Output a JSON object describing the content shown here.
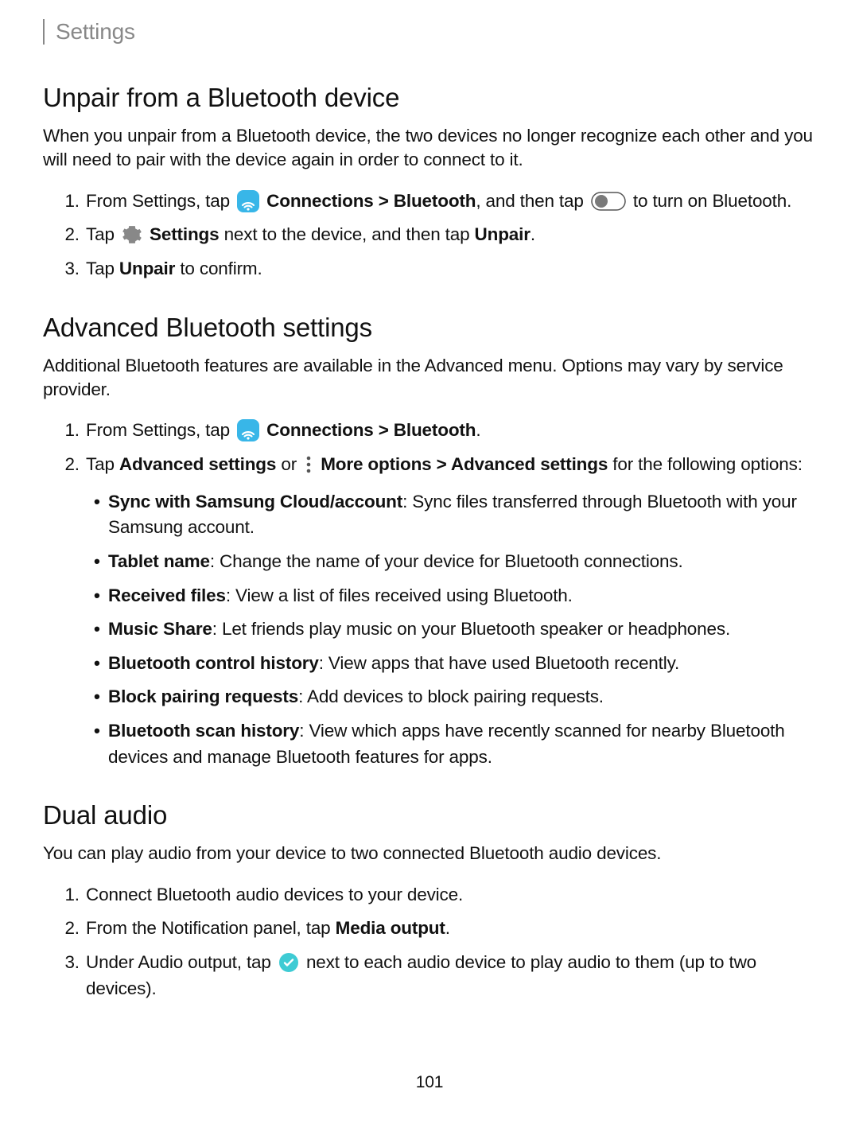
{
  "header": {
    "section": "Settings"
  },
  "unpair": {
    "title": "Unpair from a Bluetooth device",
    "intro": "When you unpair from a Bluetooth device, the two devices no longer recognize each other and you will need to pair with the device again in order to connect to it.",
    "steps": {
      "s1a": "From Settings, tap",
      "s1b": "Connections > Bluetooth",
      "s1c": ", and then tap",
      "s1d": "to turn on Bluetooth.",
      "s2a": "Tap",
      "s2b": "Settings",
      "s2c": "next to the device, and then tap",
      "s2d": "Unpair",
      "s2e": ".",
      "s3a": "Tap",
      "s3b": "Unpair",
      "s3c": "to confirm."
    }
  },
  "advanced": {
    "title": "Advanced Bluetooth settings",
    "intro": "Additional Bluetooth features are available in the Advanced menu. Options may vary by service provider.",
    "steps": {
      "s1a": "From Settings, tap",
      "s1b": "Connections > Bluetooth",
      "s1c": ".",
      "s2a": "Tap",
      "s2b": "Advanced settings",
      "s2c": "or",
      "s2d": "More options > Advanced settings",
      "s2e": "for the following options:"
    },
    "options": [
      {
        "term": "Sync with Samsung Cloud/account",
        "desc": ": Sync files transferred through Bluetooth with your Samsung account."
      },
      {
        "term": "Tablet name",
        "desc": ": Change the name of your device for Bluetooth connections."
      },
      {
        "term": "Received files",
        "desc": ": View a list of files received using Bluetooth."
      },
      {
        "term": "Music Share",
        "desc": ": Let friends play music on your Bluetooth speaker or headphones."
      },
      {
        "term": "Bluetooth control history",
        "desc": ": View apps that have used Bluetooth recently."
      },
      {
        "term": "Block pairing requests",
        "desc": ": Add devices to block pairing requests."
      },
      {
        "term": "Bluetooth scan history",
        "desc": ": View which apps have recently scanned for nearby Bluetooth devices and manage Bluetooth features for apps."
      }
    ]
  },
  "dual": {
    "title": "Dual audio",
    "intro": "You can play audio from your device to two connected Bluetooth audio devices.",
    "steps": {
      "s1": "Connect Bluetooth audio devices to your device.",
      "s2a": "From the Notification panel, tap",
      "s2b": "Media output",
      "s2c": ".",
      "s3a": "Under Audio output, tap",
      "s3b": "next to each audio device to play audio to them (up to two devices)."
    }
  },
  "page_number": "101"
}
